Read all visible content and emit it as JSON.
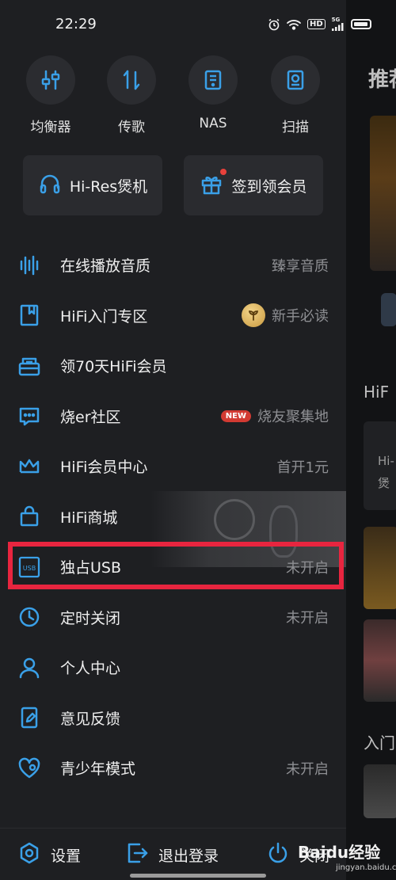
{
  "status_bar": {
    "time": "22:29",
    "icons": [
      "alarm-icon",
      "wifi-icon",
      "hd-icon",
      "signal-5g-icon",
      "battery-icon"
    ],
    "hd_label": "HD",
    "signal_label": "5G"
  },
  "quick_actions": [
    {
      "label": "均衡器",
      "icon": "equalizer-icon"
    },
    {
      "label": "传歌",
      "icon": "transfer-icon"
    },
    {
      "label": "NAS",
      "icon": "nas-icon"
    },
    {
      "label": "扫描",
      "icon": "scan-icon"
    }
  ],
  "big_buttons": [
    {
      "label": "Hi-Res煲机",
      "icon": "headphones-icon"
    },
    {
      "label": "签到领会员",
      "icon": "gift-icon",
      "has_dot": true
    }
  ],
  "menu": [
    {
      "label": "在线播放音质",
      "value": "臻享音质",
      "icon": "waveform-icon"
    },
    {
      "label": "HiFi入门专区",
      "value": "新手必读",
      "icon": "book-icon"
    },
    {
      "label": "领70天HiFi会员",
      "value": "",
      "icon": "ticket-icon"
    },
    {
      "label": "烧er社区",
      "value": "烧友聚集地",
      "badge": "NEW",
      "icon": "chat-icon"
    },
    {
      "label": "HiFi会员中心",
      "value": "首开1元",
      "icon": "crown-icon"
    },
    {
      "label": "HiFi商城",
      "value": "",
      "icon": "shopping-bag-icon"
    },
    {
      "label": "独占USB",
      "value": "未开启",
      "icon": "usb-icon",
      "icon_text": "USB"
    },
    {
      "label": "定时关闭",
      "value": "未开启",
      "icon": "clock-icon"
    },
    {
      "label": "个人中心",
      "value": "",
      "icon": "person-icon"
    },
    {
      "label": "意见反馈",
      "value": "",
      "icon": "feedback-icon"
    },
    {
      "label": "青少年模式",
      "value": "未开启",
      "icon": "heart-child-icon"
    }
  ],
  "footer": {
    "settings": "设置",
    "logout": "退出登录",
    "close": "关闭"
  },
  "background": {
    "tab": "推荐",
    "section1": "HiF",
    "card_lines": [
      "Hi-",
      "煲"
    ],
    "section2": "入门"
  },
  "watermark": {
    "text": "Baidu经验",
    "sub": "jingyan.baidu.com"
  },
  "colors": {
    "accent": "#3aa0e8",
    "highlight": "#e8253f",
    "drawer_bg": "#1e1f22"
  }
}
